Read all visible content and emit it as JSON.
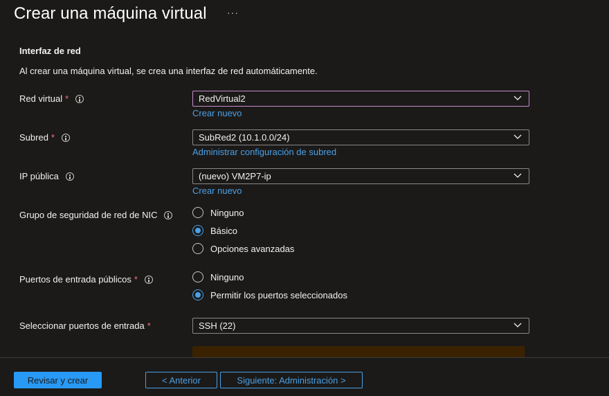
{
  "page": {
    "title": "Crear una máquina virtual",
    "more_label": "···"
  },
  "section": {
    "heading": "Interfaz de red",
    "description": "Al crear una máquina virtual, se crea una interfaz de red automáticamente."
  },
  "fields": {
    "virtual_network": {
      "label": "Red virtual",
      "required_mark": "*",
      "value": "RedVirtual2",
      "link": "Crear nuevo"
    },
    "subnet": {
      "label": "Subred",
      "required_mark": "*",
      "value": "SubRed2 (10.1.0.0/24)",
      "link": "Administrar configuración de subred"
    },
    "public_ip": {
      "label": "IP pública",
      "value": "(nuevo) VM2P7-ip",
      "link": "Crear nuevo"
    },
    "nsg": {
      "label": "Grupo de seguridad de red de NIC",
      "options": [
        "Ninguno",
        "Básico",
        "Opciones avanzadas"
      ],
      "selected": "Básico"
    },
    "public_ports": {
      "label": "Puertos de entrada públicos",
      "required_mark": "*",
      "options": [
        "Ninguno",
        "Permitir los puertos seleccionados"
      ],
      "selected": "Permitir los puertos seleccionados"
    },
    "inbound_ports": {
      "label": "Seleccionar puertos de entrada",
      "required_mark": "*",
      "value": "SSH (22)"
    }
  },
  "footer": {
    "review_create": "Revisar y crear",
    "previous": "< Anterior",
    "next": "Siguiente: Administración >"
  },
  "colors": {
    "background": "#1b1a19",
    "accent": "#2899f5",
    "link": "#4aa0e6",
    "required": "#f1707b",
    "focus_border": "#c78bcf",
    "warning_bg": "#3a2200"
  }
}
